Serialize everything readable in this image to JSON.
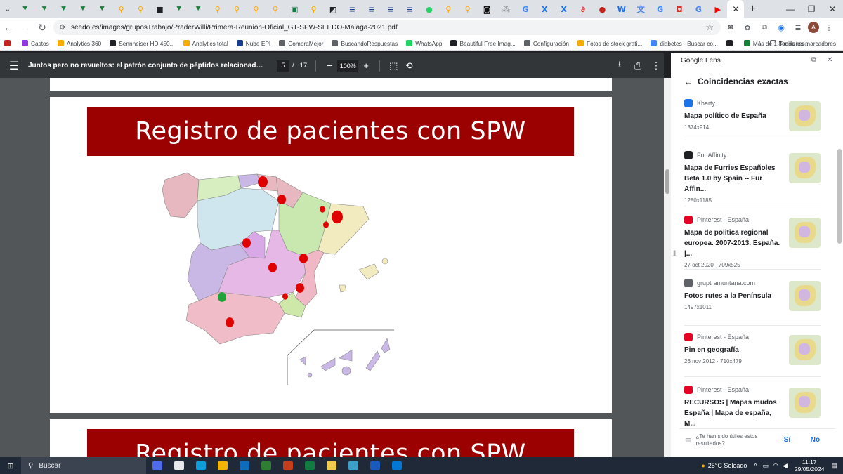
{
  "tabs": [
    {
      "icon": "chevron-green-icon",
      "color": "#188038",
      "glyph": "⯆"
    },
    {
      "icon": "chevron-green-icon",
      "color": "#188038",
      "glyph": "⯆"
    },
    {
      "icon": "chevron-green-icon",
      "color": "#188038",
      "glyph": "⯆"
    },
    {
      "icon": "chevron-green-icon",
      "color": "#188038",
      "glyph": "⯆"
    },
    {
      "icon": "chevron-green-icon",
      "color": "#188038",
      "glyph": "⯆"
    },
    {
      "icon": "search-yellow-icon",
      "color": "#f9ab00",
      "glyph": "⚲"
    },
    {
      "icon": "search-yellow-icon",
      "color": "#f9ab00",
      "glyph": "⚲"
    },
    {
      "icon": "briefcase-icon",
      "color": "#202124",
      "glyph": "■"
    },
    {
      "icon": "chevron-green-icon",
      "color": "#188038",
      "glyph": "⯆"
    },
    {
      "icon": "chevron-green-icon",
      "color": "#188038",
      "glyph": "⯆"
    },
    {
      "icon": "search-yellow-icon",
      "color": "#f9ab00",
      "glyph": "⚲"
    },
    {
      "icon": "search-yellow-icon",
      "color": "#f9ab00",
      "glyph": "⚲"
    },
    {
      "icon": "search-yellow-icon",
      "color": "#f9ab00",
      "glyph": "⚲"
    },
    {
      "icon": "search-yellow-icon",
      "color": "#f9ab00",
      "glyph": "⚲"
    },
    {
      "icon": "app-teal-icon",
      "color": "#0b8043",
      "glyph": "▣"
    },
    {
      "icon": "search-yellow-icon",
      "color": "#f9ab00",
      "glyph": "⚲"
    },
    {
      "icon": "chart-icon",
      "color": "#202124",
      "glyph": "◩"
    },
    {
      "icon": "lne-icon",
      "color": "#1a3d8f",
      "glyph": "≡"
    },
    {
      "icon": "lne-icon",
      "color": "#1a3d8f",
      "glyph": "≡"
    },
    {
      "icon": "lne-icon",
      "color": "#1a3d8f",
      "glyph": "≡"
    },
    {
      "icon": "lne-icon",
      "color": "#1a3d8f",
      "glyph": "≡"
    },
    {
      "icon": "whatsapp-icon",
      "color": "#25d366",
      "glyph": "●"
    },
    {
      "icon": "search-yellow-icon",
      "color": "#f9ab00",
      "glyph": "⚲"
    },
    {
      "icon": "search-yellow-icon",
      "color": "#f9ab00",
      "glyph": "⚲"
    },
    {
      "icon": "app-dark-icon",
      "color": "#111111",
      "glyph": "◙"
    },
    {
      "icon": "dots-icon",
      "color": "#9aa0a6",
      "glyph": "⁂"
    },
    {
      "icon": "google-icon",
      "color": "#4285f4",
      "glyph": "G"
    },
    {
      "icon": "x-blue-icon",
      "color": "#1a73e8",
      "glyph": "X"
    },
    {
      "icon": "x-blue-icon",
      "color": "#1a73e8",
      "glyph": "X"
    },
    {
      "icon": "pdf-red-icon",
      "color": "#d93025",
      "glyph": "∂"
    },
    {
      "icon": "record-icon",
      "color": "#c5221f",
      "glyph": "●"
    },
    {
      "icon": "word-blue-icon",
      "color": "#1a73e8",
      "glyph": "W"
    },
    {
      "icon": "translate-icon",
      "color": "#4285f4",
      "glyph": "文"
    },
    {
      "icon": "google-icon",
      "color": "#4285f4",
      "glyph": "G"
    },
    {
      "icon": "app-red-icon",
      "color": "#d93025",
      "glyph": "◘"
    },
    {
      "icon": "google-icon",
      "color": "#4285f4",
      "glyph": "G"
    },
    {
      "icon": "youtube-icon",
      "color": "#ff0000",
      "glyph": "▶"
    }
  ],
  "address": {
    "url": "seedo.es/images/gruposTrabajo/PraderWilli/Primera-Reunion-Oficial_GT-SPW-SEEDO-Malaga-2021.pdf"
  },
  "bookmarks": [
    {
      "label": "",
      "color": "#c5221f"
    },
    {
      "label": "Castos",
      "color": "#9334e6"
    },
    {
      "label": "Analytics 360",
      "color": "#f9ab00"
    },
    {
      "label": "Sennheiser HD 450...",
      "color": "#202124"
    },
    {
      "label": "Analytics total",
      "color": "#f9ab00"
    },
    {
      "label": "Nube EPI",
      "color": "#1a3d8f"
    },
    {
      "label": "CompraMejor",
      "color": "#5f6368"
    },
    {
      "label": "BuscandoRespuestas",
      "color": "#5f6368"
    },
    {
      "label": "WhatsApp",
      "color": "#25d366"
    },
    {
      "label": "Beautiful Free Imag...",
      "color": "#202124"
    },
    {
      "label": "Configuración",
      "color": "#5f6368"
    },
    {
      "label": "Fotos de stock grati...",
      "color": "#f9ab00"
    },
    {
      "label": "diabetes - Buscar co...",
      "color": "#4285f4"
    },
    {
      "label": "",
      "color": "#202124"
    },
    {
      "label": "Más de 1.8 millones...",
      "color": "#188038"
    }
  ],
  "bookmarks_other": "Todos los marcadores",
  "pdf": {
    "title": "Juntos pero no revueltos: el patrón conjunto de péptidos relacionados con el apetito...",
    "page_current": "5",
    "page_total": "17",
    "zoom": "100%",
    "slide_title": "Registro de pacientes con SPW",
    "next_slide_title": "Registro de pacientes con SPW",
    "map_markers": [
      {
        "region": "Asturias-Cantabria",
        "color": "#e00000"
      },
      {
        "region": "La Rioja",
        "color": "#e00000"
      },
      {
        "region": "Catalonia-north",
        "color": "#e00000"
      },
      {
        "region": "Barcelona",
        "color": "#e00000"
      },
      {
        "region": "Tarragona",
        "color": "#e00000"
      },
      {
        "region": "Madrid",
        "color": "#e00000"
      },
      {
        "region": "Castilla-La Mancha",
        "color": "#e00000"
      },
      {
        "region": "Valencia-north",
        "color": "#e00000"
      },
      {
        "region": "Valencia-south",
        "color": "#e00000"
      },
      {
        "region": "Murcia",
        "color": "#e00000"
      },
      {
        "region": "Sevilla",
        "color": "#1fa33a"
      },
      {
        "region": "Málaga",
        "color": "#e00000"
      }
    ]
  },
  "lens": {
    "title": "Google Lens",
    "subtitle": "Coincidencias exactas",
    "results": [
      {
        "source": "Kharty",
        "icon_color": "#1a73e8",
        "title": "Mapa político de España",
        "meta": "1374x914"
      },
      {
        "source": "Fur Affinity",
        "icon_color": "#202124",
        "title": "Mapa de Furries Españoles Beta 1.0 by Spain -- Fur Affin...",
        "meta": "1280x1185"
      },
      {
        "source": "Pinterest - España",
        "icon_color": "#e60023",
        "title": "Mapa de politica regional europea. 2007-2013. España. |...",
        "meta": "27 oct 2020 · 709x525"
      },
      {
        "source": "gruptramuntana.com",
        "icon_color": "#5f6368",
        "title": "Fotos rutes a la Península",
        "meta": "1497x1011"
      },
      {
        "source": "Pinterest - España",
        "icon_color": "#e60023",
        "title": "Pin en geografía",
        "meta": "26 nov 2012 · 710x479"
      },
      {
        "source": "Pinterest - España",
        "icon_color": "#e60023",
        "title": "RECURSOS | Mapas mudos España | Mapa de españa, M...",
        "meta": "29 oct 2020 · 736x497"
      }
    ],
    "feedback_question": "¿Te han sido útiles estos resultados?",
    "yes": "Sí",
    "no": "No"
  },
  "taskbar": {
    "search": "Buscar",
    "weather": "25°C Soleado",
    "time": "11:17",
    "date": "29/05/2024",
    "apps": [
      {
        "icon": "widgets-icon",
        "color": "#4f6bed"
      },
      {
        "icon": "task-view-icon",
        "color": "#e5e7eb"
      },
      {
        "icon": "edge-icon",
        "color": "#0c9ed9"
      },
      {
        "icon": "chrome-icon",
        "color": "#f4b400"
      },
      {
        "icon": "outlook-icon",
        "color": "#0f6cbd"
      },
      {
        "icon": "pen-icon",
        "color": "#2e7d32"
      },
      {
        "icon": "powerpoint-icon",
        "color": "#c43e1c"
      },
      {
        "icon": "excel-icon",
        "color": "#107c41"
      },
      {
        "icon": "explorer-icon",
        "color": "#f2c94c"
      },
      {
        "icon": "paint-icon",
        "color": "#3aa0c8"
      },
      {
        "icon": "word-icon",
        "color": "#185abd"
      },
      {
        "icon": "defender-icon",
        "color": "#0078d4"
      }
    ]
  }
}
